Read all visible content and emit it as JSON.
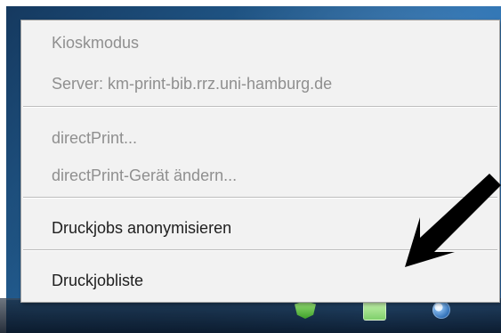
{
  "menu": {
    "items": [
      {
        "label": "Kioskmodus"
      },
      {
        "label": "Server: km-print-bib.rrz.uni-hamburg.de"
      },
      {
        "label": "directPrint..."
      },
      {
        "label": "directPrint-Gerät ändern..."
      },
      {
        "label": "Druckjobs anonymisieren"
      },
      {
        "label": "Druckjobliste"
      }
    ]
  },
  "icons": {
    "tray_icon_1": "shield-icon",
    "tray_icon_2": "printer-icon",
    "tray_icon_3": "globe-icon",
    "annotation": "arrow-icon"
  },
  "colors": {
    "desktop_blue": "#2b71b1",
    "menu_background": "#f2f2f2",
    "disabled_text": "#8f8f8f",
    "enabled_text": "#202020",
    "arrow": "#000000"
  }
}
